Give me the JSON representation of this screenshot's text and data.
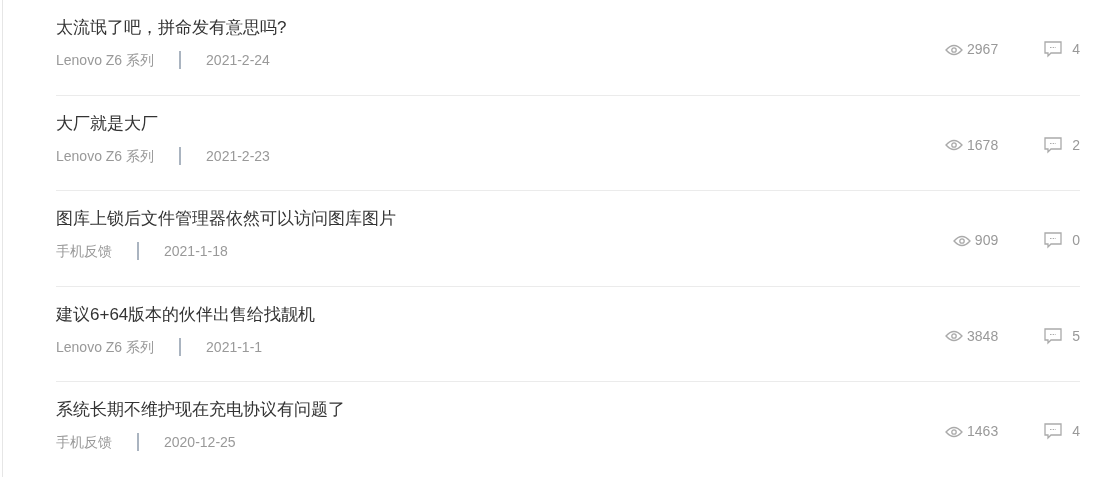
{
  "posts": [
    {
      "title": "太流氓了吧，拼命发有意思吗?",
      "category": "Lenovo Z6 系列",
      "date": "2021-2-24",
      "views": "2967",
      "comments": "4"
    },
    {
      "title": "大厂就是大厂",
      "category": "Lenovo Z6 系列",
      "date": "2021-2-23",
      "views": "1678",
      "comments": "2"
    },
    {
      "title": "图库上锁后文件管理器依然可以访问图库图片",
      "category": "手机反馈",
      "date": "2021-1-18",
      "views": "909",
      "comments": "0"
    },
    {
      "title": "建议6+64版本的伙伴出售给找靓机",
      "category": "Lenovo Z6 系列",
      "date": "2021-1-1",
      "views": "3848",
      "comments": "5"
    },
    {
      "title": "系统长期不维护现在充电协议有问题了",
      "category": "手机反馈",
      "date": "2020-12-25",
      "views": "1463",
      "comments": "4"
    }
  ]
}
